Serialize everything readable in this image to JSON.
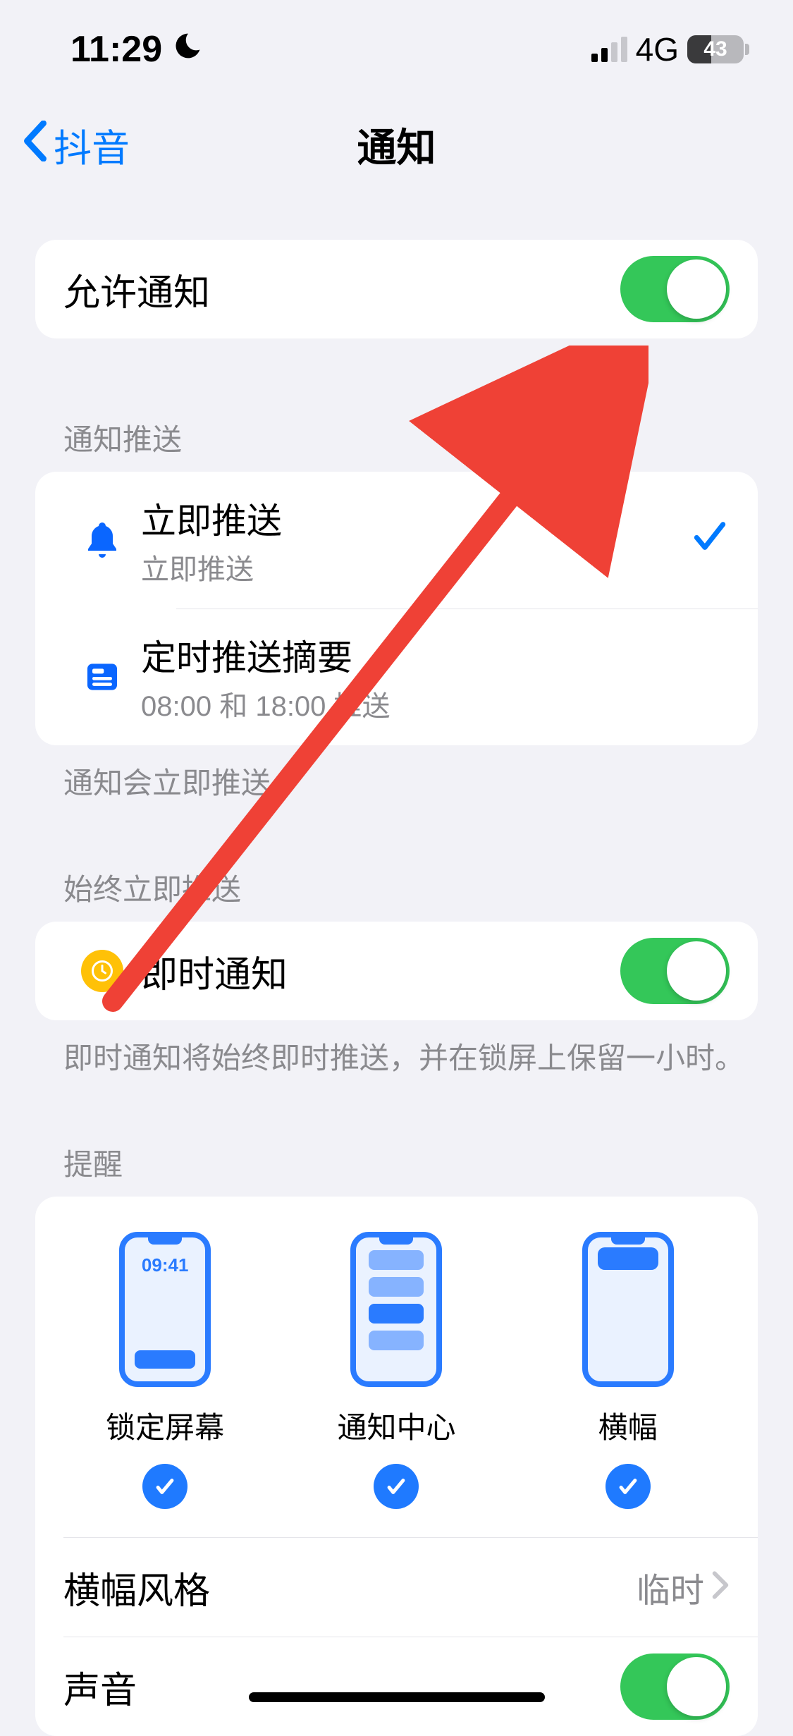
{
  "status": {
    "time": "11:29",
    "network": "4G",
    "battery_text": "43"
  },
  "nav": {
    "back_label": "抖音",
    "title": "通知"
  },
  "allow": {
    "label": "允许通知",
    "on": true
  },
  "delivery": {
    "header": "通知推送",
    "items": [
      {
        "title": "立即推送",
        "subtitle": "立即推送",
        "selected": true
      },
      {
        "title": "定时推送摘要",
        "subtitle": "08:00 和 18:00 推送",
        "selected": false
      }
    ],
    "footer": "通知会立即推送。"
  },
  "always_deliver": {
    "header": "始终立即推送",
    "item_label": "即时通知",
    "on": true,
    "footer": "即时通知将始终即时推送，并在锁屏上保留一小时。"
  },
  "alerts": {
    "header": "提醒",
    "options": [
      {
        "label": "锁定屏幕",
        "checked": true,
        "lock_time": "09:41"
      },
      {
        "label": "通知中心",
        "checked": true
      },
      {
        "label": "横幅",
        "checked": true
      }
    ],
    "banner_style": {
      "label": "横幅风格",
      "value": "临时"
    },
    "sound": {
      "label": "声音",
      "on": true
    }
  }
}
